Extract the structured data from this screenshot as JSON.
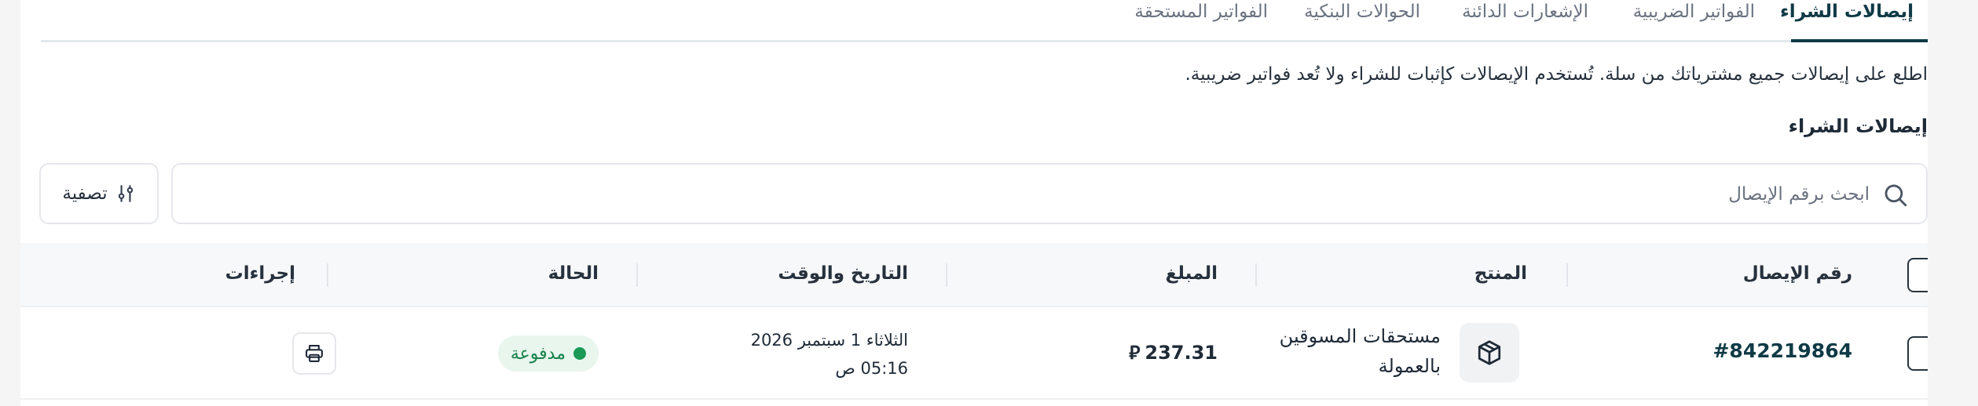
{
  "tabs": [
    {
      "label": "إيصالات الشراء",
      "active": true
    },
    {
      "label": "الفواتير الضريبية",
      "active": false
    },
    {
      "label": "الإشعارات الدائنة",
      "active": false
    },
    {
      "label": "الحوالات البنكية",
      "active": false
    },
    {
      "label": "الفواتير المستحقة",
      "active": false
    }
  ],
  "description": "اطلع على إيصالات جميع مشترياتك من سلة. تُستخدم الإيصالات كإثبات للشراء ولا تُعد فواتير ضريبية.",
  "section_title": "إيصالات الشراء",
  "search": {
    "placeholder": "ابحث برقم الإيصال",
    "value": ""
  },
  "filter": {
    "label": "تصفية"
  },
  "table": {
    "headers": {
      "receipt_no": "رقم الإيصال",
      "product": "المنتج",
      "amount": "المبلغ",
      "datetime": "التاريخ والوقت",
      "status": "الحالة",
      "actions": "إجراءات"
    },
    "rows": [
      {
        "receipt_no": "#842219864",
        "product_line1": "مستحقات المسوقين",
        "product_line2": "بالعمولة",
        "amount": "237.31",
        "currency_symbol": "⃁",
        "date": "الثلاثاء 1 سبتمبر 2026",
        "time": "05:16 ص",
        "status": "مدفوعة"
      }
    ]
  },
  "colors": {
    "accent": "#0f3a46",
    "status_paid": "#1a9a55",
    "status_bg": "#e8f6ee"
  }
}
